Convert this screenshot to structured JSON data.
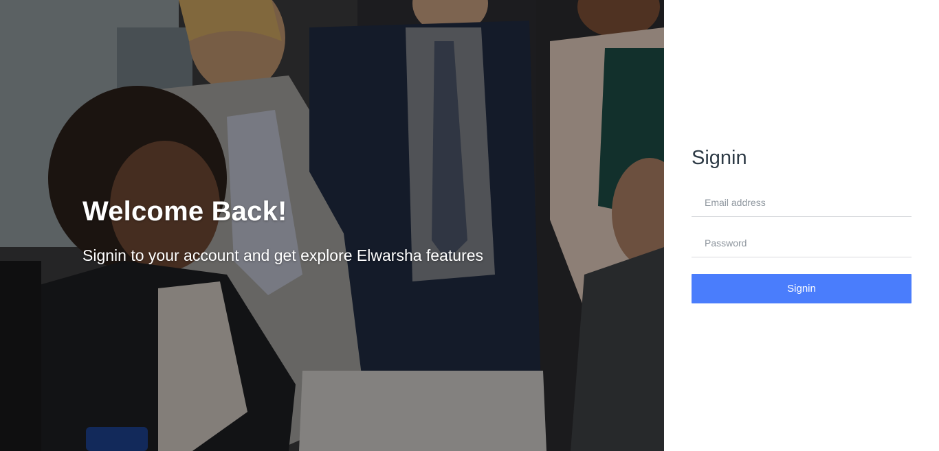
{
  "hero": {
    "heading": "Welcome Back!",
    "subheading": "Signin to your account and get explore Elwarsha features"
  },
  "signin": {
    "title": "Signin",
    "email_placeholder": "Email address",
    "password_placeholder": "Password",
    "submit_label": "Signin"
  },
  "colors": {
    "accent": "#4a7dfc",
    "title_text": "#2d3a45",
    "field_border": "#d7d9dc"
  }
}
